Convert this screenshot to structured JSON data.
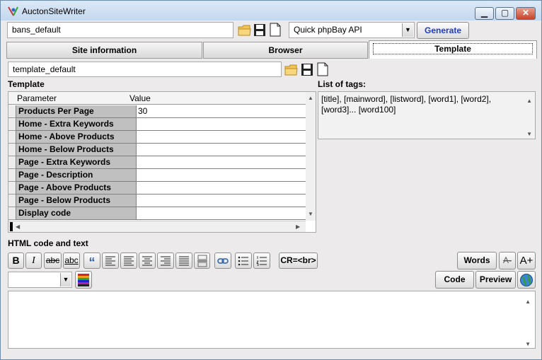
{
  "window": {
    "title": "AuctonSiteWriter"
  },
  "top": {
    "project_value": "bans_default",
    "api_select": "Quick phpBay API",
    "generate_label": "Generate"
  },
  "tabs": [
    "Site information",
    "Browser",
    "Template"
  ],
  "template_bar": {
    "template_value": "template_default"
  },
  "template_section": {
    "label": "Template",
    "col_param": "Parameter",
    "col_value": "Value"
  },
  "parameters": [
    {
      "name": "Products Per Page",
      "value": "30"
    },
    {
      "name": "Home - Extra Keywords",
      "value": ""
    },
    {
      "name": "Home - Above Products",
      "value": ""
    },
    {
      "name": "Home - Below Products",
      "value": ""
    },
    {
      "name": "Page - Extra Keywords",
      "value": ""
    },
    {
      "name": "Page - Description",
      "value": ""
    },
    {
      "name": "Page - Above Products",
      "value": ""
    },
    {
      "name": "Page - Below Products",
      "value": ""
    },
    {
      "name": "Display code",
      "value": ""
    }
  ],
  "tags": {
    "label": "List of tags:",
    "text": "[title], [mainword], [listword], [word1], [word2], [word3]... [word100]"
  },
  "html_section": {
    "label": "HTML code and text"
  },
  "toolbar": {
    "bold": "B",
    "italic": "I",
    "strike": "abc",
    "underline": "abc",
    "quote": "“",
    "cr_br": "CR=<br>",
    "words": "Words",
    "font_smaller": "A-",
    "font_larger": "A+",
    "code": "Code",
    "preview": "Preview"
  },
  "editor": {
    "content": ""
  }
}
